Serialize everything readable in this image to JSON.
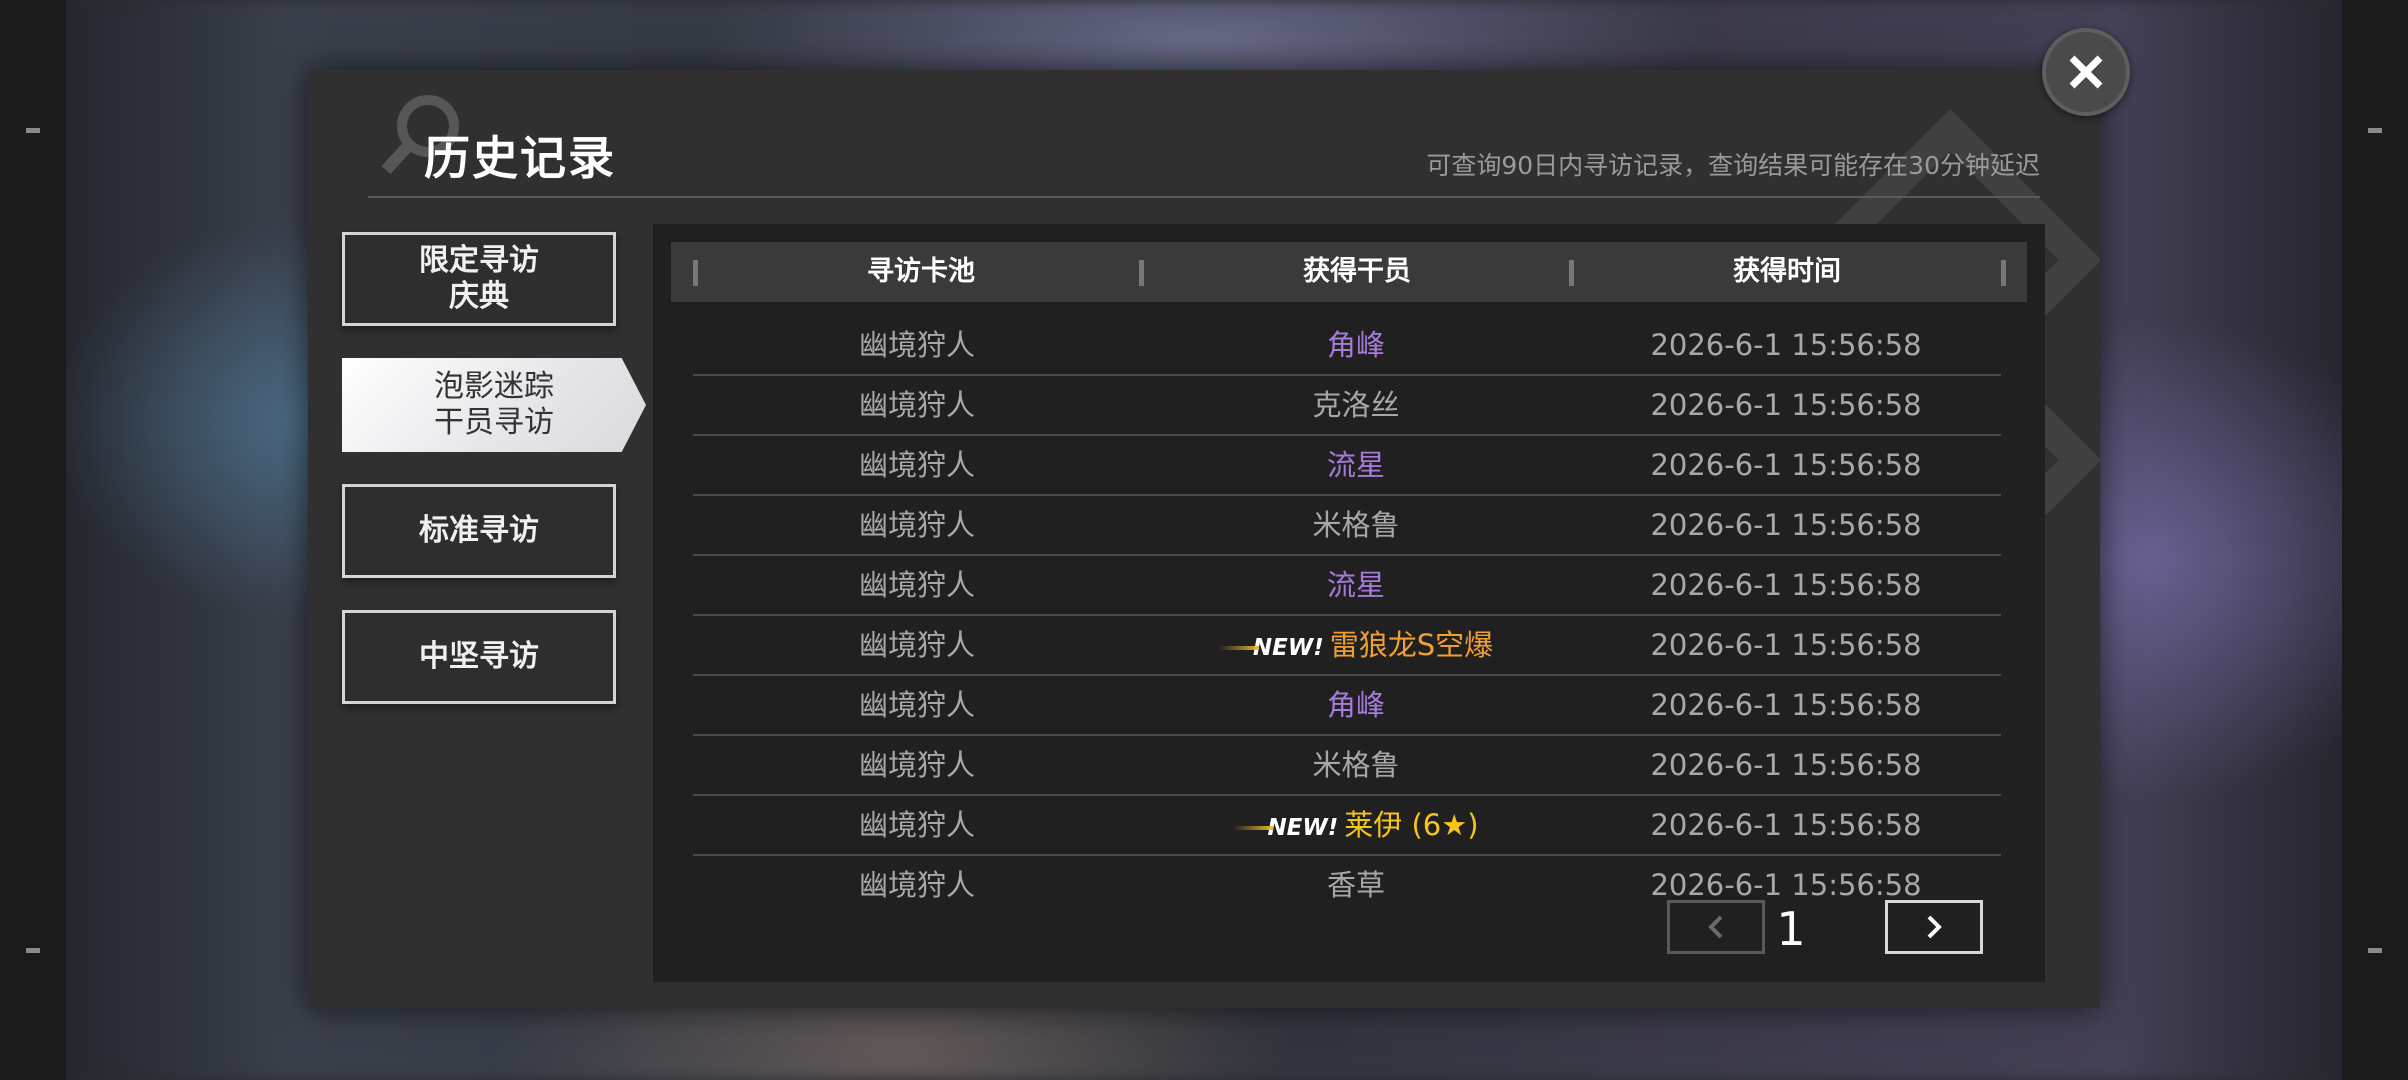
{
  "header": {
    "title": "历史记录",
    "subtitle": "可查询90日内寻访记录，查询结果可能存在30分钟延迟"
  },
  "tabs": [
    {
      "label": "限定寻访\n庆典",
      "active": false
    },
    {
      "label": "泡影迷踪\n干员寻访",
      "active": true
    },
    {
      "label": "标准寻访",
      "active": false
    },
    {
      "label": "中坚寻访",
      "active": false
    }
  ],
  "table": {
    "columns": [
      "寻访卡池",
      "获得干员",
      "获得时间"
    ],
    "rows": [
      {
        "pool": "幽境狩人",
        "operator": "角峰",
        "new": false,
        "badge": "",
        "rarity_color": "#a57ad9",
        "time": "2026-6-1 15:56:58"
      },
      {
        "pool": "幽境狩人",
        "operator": "克洛丝",
        "new": false,
        "badge": "",
        "rarity_color": "#a8a8a8",
        "time": "2026-6-1 15:56:58"
      },
      {
        "pool": "幽境狩人",
        "operator": "流星",
        "new": false,
        "badge": "",
        "rarity_color": "#a57ad9",
        "time": "2026-6-1 15:56:58"
      },
      {
        "pool": "幽境狩人",
        "operator": "米格鲁",
        "new": false,
        "badge": "",
        "rarity_color": "#a8a8a8",
        "time": "2026-6-1 15:56:58"
      },
      {
        "pool": "幽境狩人",
        "operator": "流星",
        "new": false,
        "badge": "",
        "rarity_color": "#a57ad9",
        "time": "2026-6-1 15:56:58"
      },
      {
        "pool": "幽境狩人",
        "operator": "雷狼龙S空爆",
        "new": true,
        "badge": "NEW!",
        "rarity_color": "#f0a030",
        "time": "2026-6-1 15:56:58"
      },
      {
        "pool": "幽境狩人",
        "operator": "角峰",
        "new": false,
        "badge": "",
        "rarity_color": "#a57ad9",
        "time": "2026-6-1 15:56:58"
      },
      {
        "pool": "幽境狩人",
        "operator": "米格鲁",
        "new": false,
        "badge": "",
        "rarity_color": "#a8a8a8",
        "time": "2026-6-1 15:56:58"
      },
      {
        "pool": "幽境狩人",
        "operator": "莱伊 (6★)",
        "new": true,
        "badge": "NEW!",
        "rarity_color": "#f5c518",
        "time": "2026-6-1 15:56:58"
      },
      {
        "pool": "幽境狩人",
        "operator": "香草",
        "new": false,
        "badge": "",
        "rarity_color": "#a8a8a8",
        "time": "2026-6-1 15:56:58"
      }
    ]
  },
  "pager": {
    "prev_icon": "chevron-left-icon",
    "next_icon": "chevron-right-icon",
    "page": "1"
  },
  "close_icon": "close-icon"
}
